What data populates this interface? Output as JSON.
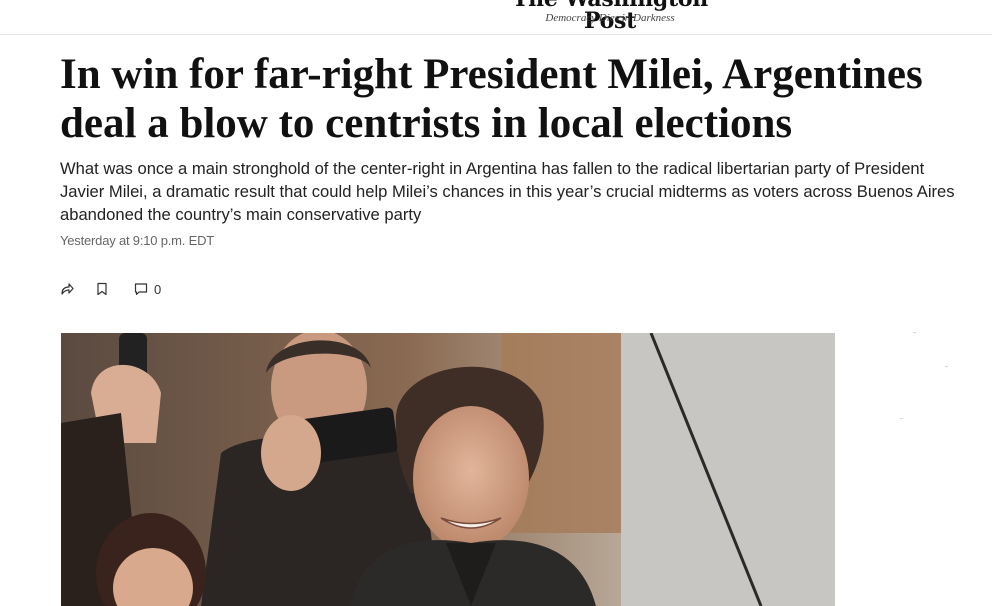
{
  "masthead": {
    "logo": "The Washington Post",
    "tagline": "Democracy Dies in Darkness"
  },
  "article": {
    "headline": "In win for far-right President Milei, Argentines deal a blow to centrists in local elections",
    "dek": "What was once a main stronghold of the center-right in Argentina has fallen to the radical libertarian party of President Javier Milei, a dramatic result that could help Milei’s chances in this year’s crucial midterms as voters across Buenos Aires abandoned the country’s main conservative party",
    "timestamp": "Yesterday at 9:10 p.m. EDT"
  },
  "actions": {
    "share_icon": "share-icon",
    "save_icon": "bookmark-icon",
    "comment_icon": "comment-icon",
    "comment_count": "0"
  },
  "image": {
    "subject": "photo-of-smiling-man-in-crowd"
  }
}
